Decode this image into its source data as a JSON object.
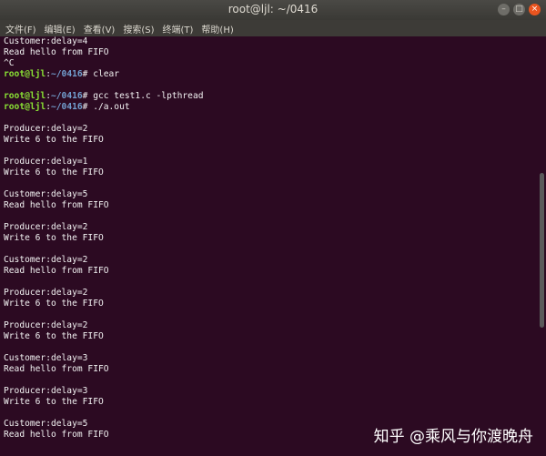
{
  "window": {
    "title": "root@ljl: ~/0416",
    "buttons": [
      "–",
      "□",
      "×"
    ]
  },
  "menu": [
    "文件(F)",
    "编辑(E)",
    "查看(V)",
    "搜索(S)",
    "终端(T)",
    "帮助(H)"
  ],
  "terminal": {
    "lines": [
      "Customer:delay=4",
      "Read hello from FIFO",
      "^C",
      {
        "user": "root@ljl",
        "sep": ":",
        "path": "~/0416",
        "cmd": "# clear"
      },
      "",
      {
        "user": "root@ljl",
        "sep": ":",
        "path": "~/0416",
        "cmd": "# gcc test1.c -lpthread"
      },
      {
        "user": "root@ljl",
        "sep": ":",
        "path": "~/0416",
        "cmd": "# ./a.out"
      },
      "",
      "Producer:delay=2",
      "Write 6 to the FIFO",
      "",
      "Producer:delay=1",
      "Write 6 to the FIFO",
      "",
      "Customer:delay=5",
      "Read hello from FIFO",
      "",
      "Producer:delay=2",
      "Write 6 to the FIFO",
      "",
      "Customer:delay=2",
      "Read hello from FIFO",
      "",
      "Producer:delay=2",
      "Write 6 to the FIFO",
      "",
      "Producer:delay=2",
      "Write 6 to the FIFO",
      "",
      "Customer:delay=3",
      "Read hello from FIFO",
      "",
      "Producer:delay=3",
      "Write 6 to the FIFO",
      "",
      "Customer:delay=5",
      "Read hello from FIFO"
    ]
  },
  "watermark": "知乎 @乘风与你渡晚舟",
  "colors": {
    "background": "#2c0a22",
    "prompt_user": "#8ae234",
    "prompt_path": "#729fcf",
    "text": "#f2f2f2"
  }
}
